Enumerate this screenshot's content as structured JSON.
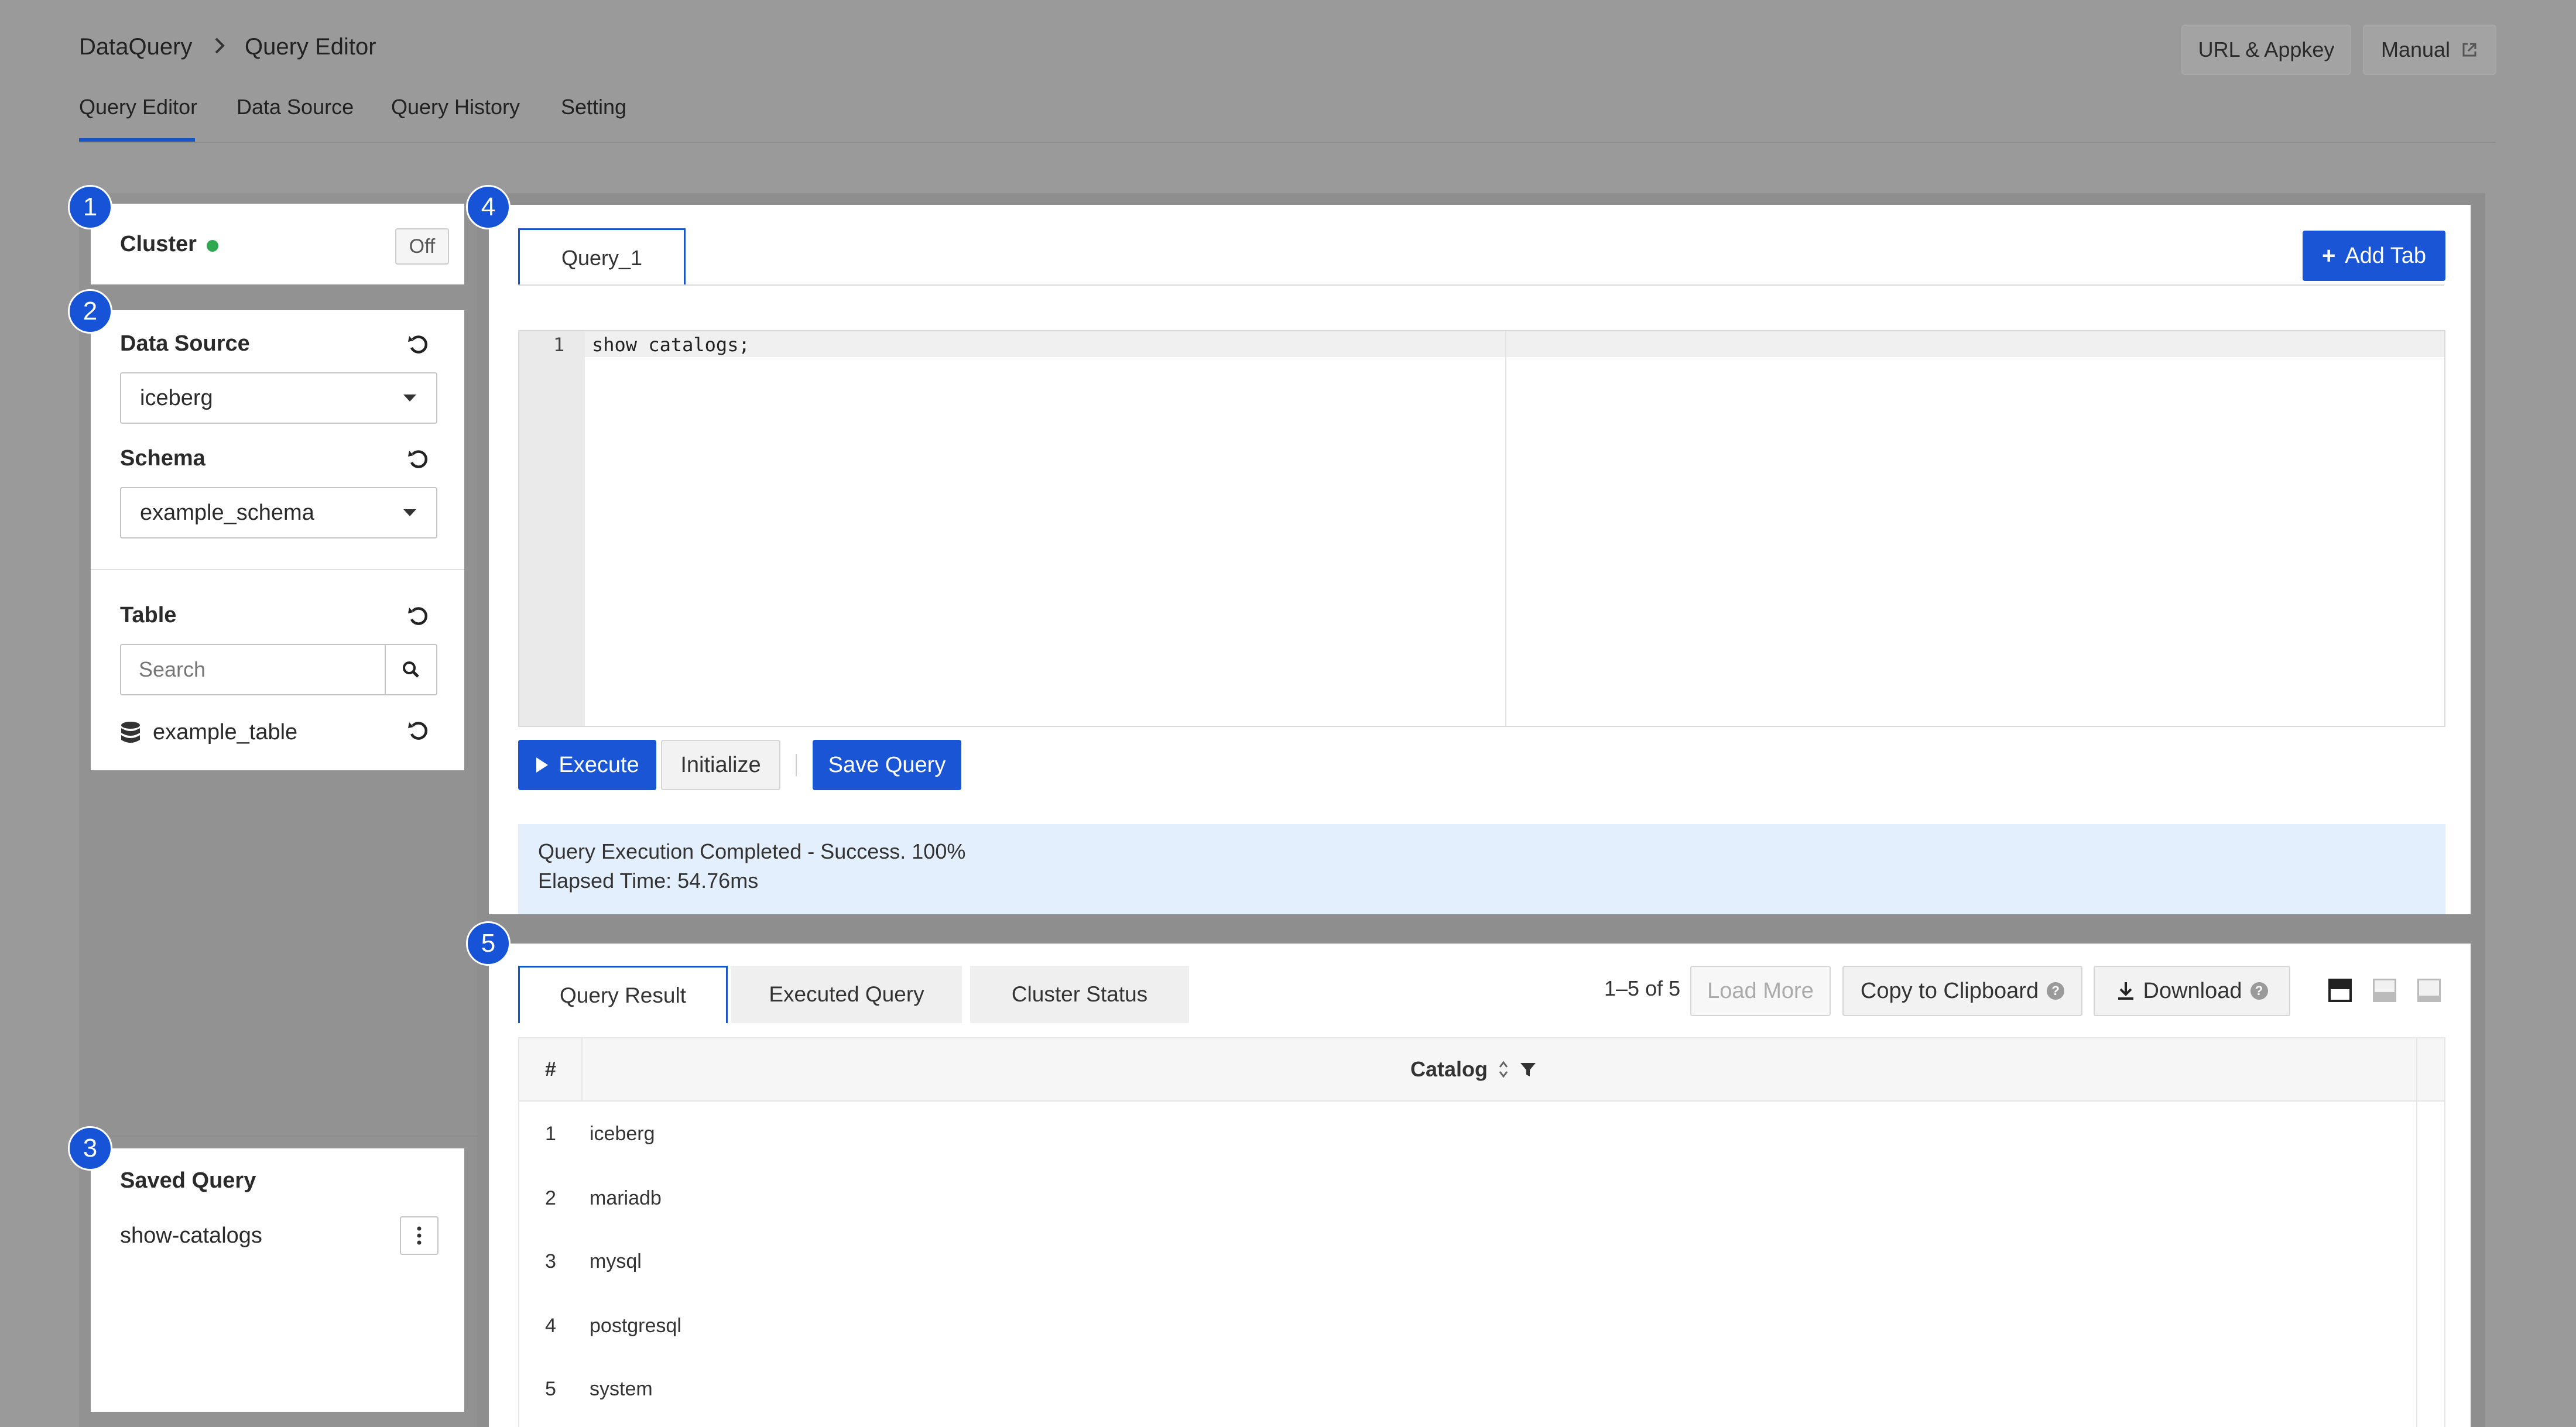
{
  "breadcrumb": {
    "root": "DataQuery",
    "current": "Query Editor"
  },
  "header_buttons": {
    "url_appkey": "URL & Appkey",
    "manual": "Manual"
  },
  "nav_tabs": [
    "Query Editor",
    "Data Source",
    "Query History",
    "Setting"
  ],
  "badges": [
    "1",
    "2",
    "3",
    "4",
    "5"
  ],
  "cluster": {
    "label": "Cluster",
    "status_color": "#2fa84f",
    "toggle": "Off"
  },
  "data_source": {
    "label": "Data Source",
    "value": "iceberg",
    "schema_label": "Schema",
    "schema_value": "example_schema",
    "table_label": "Table",
    "search_placeholder": "Search",
    "tables": [
      "example_table"
    ]
  },
  "saved_query": {
    "label": "Saved Query",
    "items": [
      "show-catalogs"
    ]
  },
  "editor": {
    "tab": "Query_1",
    "add_tab": "Add Tab",
    "line_numbers": [
      "1"
    ],
    "code_lines": [
      "show catalogs;"
    ],
    "execute": "Execute",
    "initialize": "Initialize",
    "save_query": "Save Query",
    "status_line1": "Query Execution Completed - Success. 100%",
    "status_line2": "Elapsed Time: 54.76ms"
  },
  "results": {
    "tabs": [
      "Query Result",
      "Executed Query",
      "Cluster Status"
    ],
    "range": "1–5 of 5",
    "load_more": "Load More",
    "copy": "Copy to Clipboard",
    "download": "Download",
    "columns": {
      "index": "#",
      "catalog": "Catalog"
    },
    "rows": [
      {
        "n": "1",
        "catalog": "iceberg"
      },
      {
        "n": "2",
        "catalog": "mariadb"
      },
      {
        "n": "3",
        "catalog": "mysql"
      },
      {
        "n": "4",
        "catalog": "postgresql"
      },
      {
        "n": "5",
        "catalog": "system"
      }
    ]
  },
  "colors": {
    "accent": "#1a55d6",
    "badge": "#1653d6",
    "status_bg": "#e3effc",
    "overlay": "#9a9a9a"
  }
}
